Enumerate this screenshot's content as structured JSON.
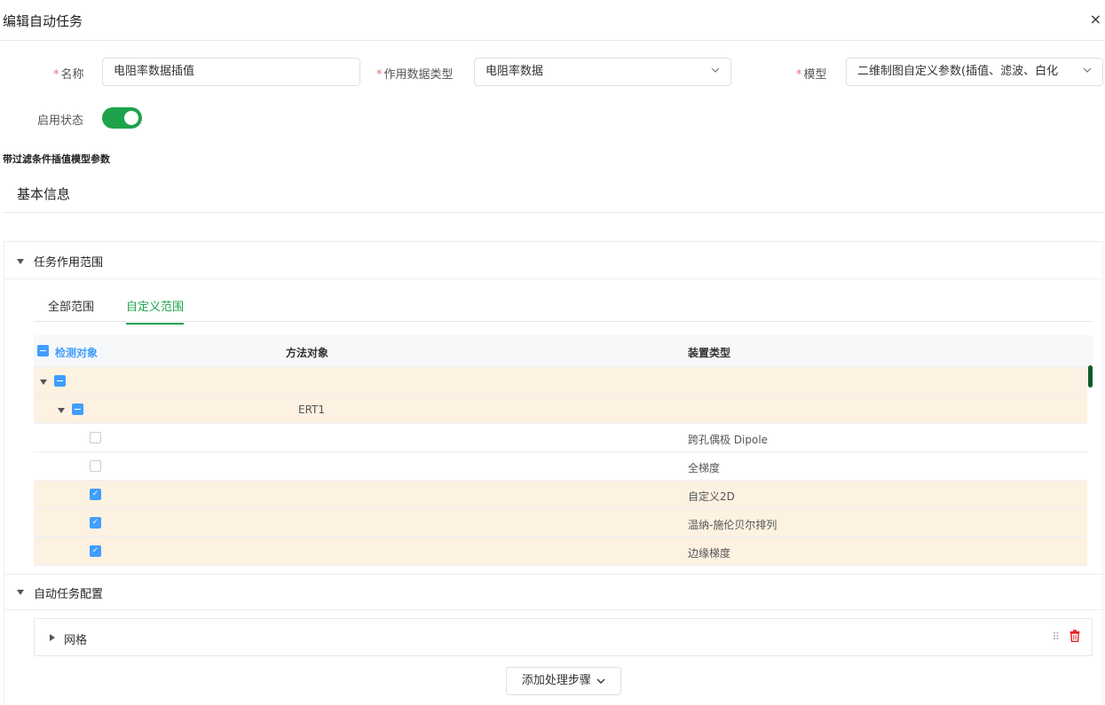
{
  "dialog": {
    "title": "编辑自动任务",
    "close": "×"
  },
  "form": {
    "name_label": "名称",
    "name_value": "电阻率数据插值",
    "data_type_label": "作用数据类型",
    "data_type_value": "电阻率数据",
    "model_label": "模型",
    "model_value": "二维制图自定义参数(插值、滤波、白化",
    "enabled_label": "启用状态",
    "enabled": true
  },
  "section_caption": "带过滤条件插值模型参数",
  "basic_info": "基本信息",
  "scope_panel": {
    "title": "任务作用范围",
    "tabs": [
      {
        "label": "全部范围",
        "active": false
      },
      {
        "label": "自定义范围",
        "active": true
      }
    ],
    "columns": [
      "检测对象",
      "方法对象",
      "装置类型"
    ],
    "rows": [
      {
        "level": 0,
        "state": "indeterminate",
        "method": "",
        "device": ""
      },
      {
        "level": 1,
        "state": "indeterminate",
        "method": "ERT1",
        "device": ""
      },
      {
        "level": 2,
        "state": "unchecked",
        "method": "",
        "device": "跨孔偶极 Dipole"
      },
      {
        "level": 2,
        "state": "unchecked",
        "method": "",
        "device": "全梯度"
      },
      {
        "level": 2,
        "state": "checked",
        "method": "",
        "device": "自定义2D"
      },
      {
        "level": 2,
        "state": "checked",
        "method": "",
        "device": "温纳-施伦贝尔排列"
      },
      {
        "level": 2,
        "state": "checked",
        "method": "",
        "device": "边缘梯度"
      }
    ]
  },
  "config_panel": {
    "title": "自动任务配置",
    "items": [
      {
        "label": "网格"
      }
    ],
    "add_step_label": "添加处理步骤"
  },
  "colors": {
    "accent": "#1ea34a",
    "checkbox": "#409eff",
    "highlight_row": "#fdf1e1",
    "required": "#f56c6c",
    "danger": "#e02020"
  },
  "icons": {
    "close": "close-icon",
    "select": "chevron-down-icon",
    "drag": "drag-handle-icon",
    "delete": "trash-icon"
  }
}
